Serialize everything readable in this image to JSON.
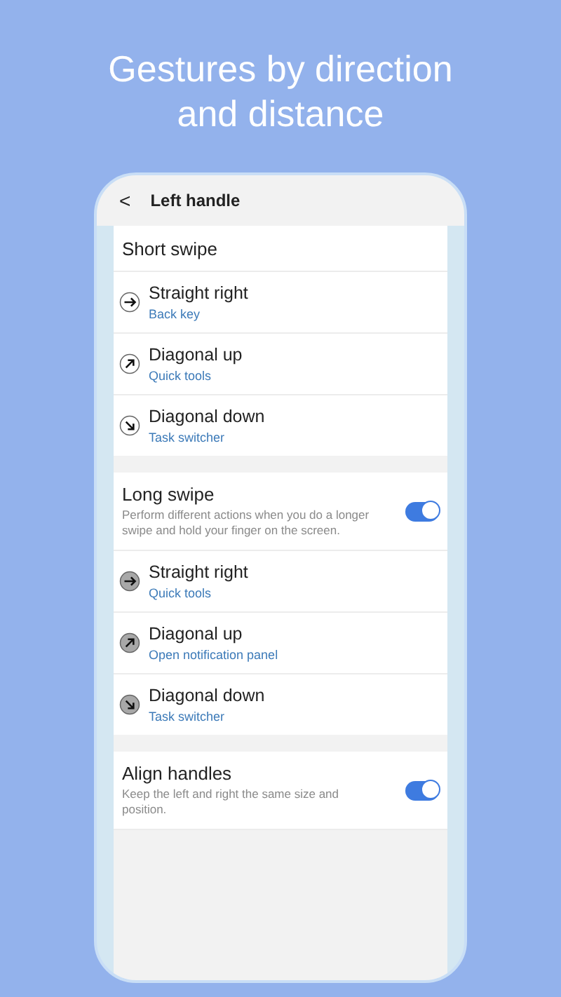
{
  "headline": "Gestures by direction and distance",
  "screen": {
    "back": "<",
    "title": "Left handle"
  },
  "sections": [
    {
      "kind": "outline",
      "title": "Short swipe",
      "items": [
        {
          "kind": "right",
          "title": "Straight right",
          "value": "Back key"
        },
        {
          "kind": "up",
          "title": "Diagonal up",
          "value": "Quick tools"
        },
        {
          "kind": "down",
          "title": "Diagonal down",
          "value": "Task switcher"
        }
      ]
    },
    {
      "kind": "filled",
      "title": "Long swipe",
      "description": "Perform different actions when you do a longer swipe and hold your finger on the screen.",
      "on": true,
      "items": [
        {
          "kind": "right",
          "title": "Straight right",
          "value": "Quick tools"
        },
        {
          "kind": "up",
          "title": "Diagonal up",
          "value": "Open notification panel"
        },
        {
          "kind": "down",
          "title": "Diagonal down",
          "value": "Task switcher"
        }
      ]
    },
    {
      "title": "Align handles",
      "description": "Keep the left and right the same size and position.",
      "on": true
    }
  ]
}
